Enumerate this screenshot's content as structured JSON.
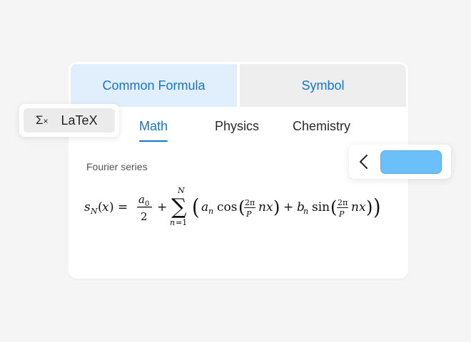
{
  "panel": {
    "tabs": [
      {
        "label": "Common Formula",
        "active": true
      },
      {
        "label": "Symbol",
        "active": false
      }
    ],
    "categories": [
      {
        "label": "Math",
        "active": true
      },
      {
        "label": "Physics",
        "active": false
      },
      {
        "label": "Chemistry",
        "active": false
      }
    ],
    "formula": {
      "title": "Fourier series",
      "latex": "s_N(x) = \\frac{a_0}{2} + \\sum_{n=1}^{N} \\left( a_n \\cos\\left(\\frac{2\\pi}{P} nx\\right) + b_n \\sin\\left(\\frac{2\\pi}{P} nx\\right) \\right)"
    }
  },
  "latex_button": {
    "icon": "sigma-x-icon",
    "label": "LaTeX"
  },
  "nav": {
    "back_icon": "chevron-left-icon",
    "accent_color": "#6cc0fa"
  },
  "colors": {
    "accent": "#1576d0",
    "tab_active_bg": "#e1eefb",
    "tab_inactive_bg": "#eeeeef",
    "background": "#f5f5f6"
  }
}
